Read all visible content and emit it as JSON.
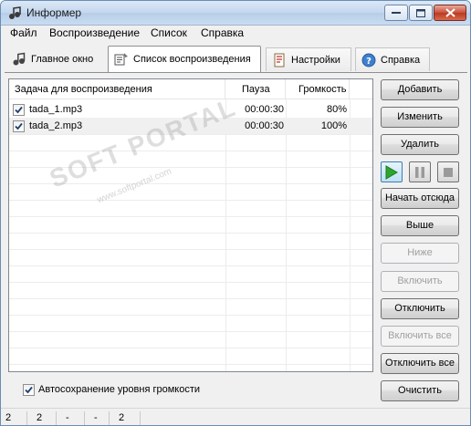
{
  "window": {
    "title": "Информер",
    "minimize_label": "—",
    "maximize_label": "□",
    "close_label": "✕"
  },
  "menu": {
    "items": [
      "Файл",
      "Воспроизведение",
      "Список",
      "Справка"
    ]
  },
  "tabs": [
    {
      "label": "Главное окно",
      "icon": "music-notes-icon",
      "active": false
    },
    {
      "label": "Список воспроизведения",
      "icon": "playlist-icon",
      "active": true
    },
    {
      "label": "Настройки",
      "icon": "settings-document-icon",
      "active": false
    },
    {
      "label": "Справка",
      "icon": "help-icon",
      "active": false
    }
  ],
  "playlist": {
    "columns": [
      "Задача для воспроизведения",
      "Пауза",
      "Громкость"
    ],
    "rows": [
      {
        "checked": true,
        "name": "tada_1.mp3",
        "pause": "00:00:30",
        "volume": "80%"
      },
      {
        "checked": true,
        "name": "tada_2.mp3",
        "pause": "00:00:30",
        "volume": "100%"
      }
    ]
  },
  "watermark": {
    "text": "SOFT PORTAL",
    "sub": "www.softportal.com"
  },
  "buttons": {
    "add": "Добавить",
    "edit": "Изменить",
    "delete": "Удалить",
    "start_from_here": "Начать отсюда",
    "move_up": "Выше",
    "move_down": "Ниже",
    "enable": "Включить",
    "disable": "Отключить",
    "enable_all": "Включить все",
    "disable_all": "Отключить все",
    "clear": "Очистить"
  },
  "button_state": {
    "move_down_enabled": false,
    "enable_enabled": false,
    "enable_all_enabled": false
  },
  "media": {
    "play_icon": "play-icon",
    "pause_icon": "pause-icon",
    "stop_icon": "stop-icon"
  },
  "autosave": {
    "checked": true,
    "label": "Автосохранение уровня громкости"
  },
  "statusbar": {
    "cells": [
      "2",
      "2",
      "-",
      "-",
      "2"
    ]
  },
  "colors": {
    "play_green": "#2ea52e",
    "accent_blue": "#3c7fb1",
    "disabled_text": "#a0a0a0"
  }
}
